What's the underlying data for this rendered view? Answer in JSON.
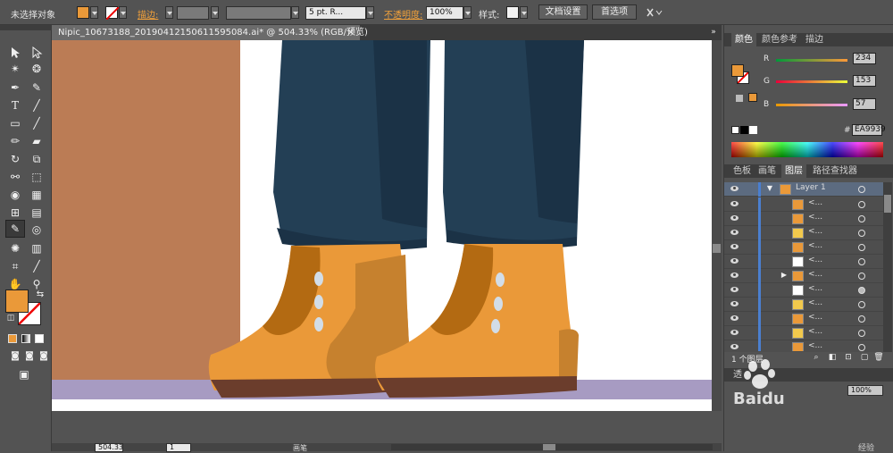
{
  "control_bar": {
    "selection_label": "未选择对象",
    "fill_color": "#EA9939",
    "stroke_label": "描边:",
    "brush_label": "5 pt. R...",
    "opacity_label": "不透明度:",
    "opacity_value": "100%",
    "style_label": "样式:",
    "doc_setup_button": "文档设置",
    "prefs_button": "首选项"
  },
  "document": {
    "tab_title": "Nipic_10673188_20190412150611595084.ai* @ 504.33% (RGB/预览)",
    "close": "×"
  },
  "status_bar": {
    "zoom": "504.33",
    "artboard": "1",
    "mode": "画笔"
  },
  "color_panel": {
    "tabs": [
      "颜色",
      "颜色参考",
      "描边"
    ],
    "r_label": "R",
    "r_value": "234",
    "g_label": "G",
    "g_value": "153",
    "b_label": "B",
    "b_value": "57",
    "hex_label": "#",
    "hex_value": "EA9939"
  },
  "layers_panel": {
    "tabs": [
      "色板",
      "画笔",
      "图层",
      "路径查找器"
    ],
    "layer_name": "Layer 1",
    "sublayer_label": "<...",
    "count_label": "1 个图层"
  },
  "lower_panel": {
    "tab_label": "透",
    "opacity_value": "100%"
  },
  "watermark": {
    "brand": "Baidu",
    "sub": "经验"
  },
  "colors": {
    "boot": "#EA9939",
    "boot_dark": "#B36A12",
    "boot_shade": "#C6812E",
    "sole": "#6B3D2C",
    "jeans": "#233F55",
    "jeans_dark": "#1B3246",
    "floor": "#A79BC2",
    "wall": "#BB7C55",
    "eyelet": "#D2DDE8"
  }
}
